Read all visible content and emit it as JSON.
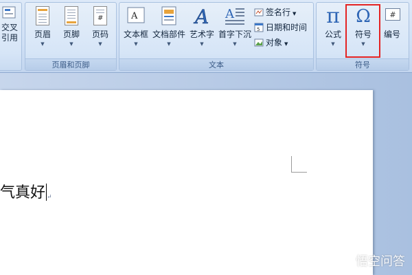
{
  "ribbon": {
    "partial_group": {
      "label_lines": [
        "交叉",
        "引用"
      ]
    },
    "header_footer_group": {
      "label": "页眉和页脚",
      "buttons": [
        {
          "label": "页眉",
          "icon": "header-page-icon"
        },
        {
          "label": "页脚",
          "icon": "footer-page-icon"
        },
        {
          "label": "页码",
          "icon": "page-number-icon"
        }
      ]
    },
    "text_group": {
      "label": "文本",
      "buttons": [
        {
          "label": "文本框",
          "icon": "text-box-icon"
        },
        {
          "label": "文档部件",
          "icon": "quick-parts-icon"
        },
        {
          "label": "艺术字",
          "icon": "wordart-icon"
        },
        {
          "label": "首字下沉",
          "icon": "drop-cap-icon"
        }
      ],
      "small_buttons": [
        {
          "label": "签名行",
          "icon": "signature-line-icon"
        },
        {
          "label": "日期和时间",
          "icon": "date-time-icon"
        },
        {
          "label": "对象",
          "icon": "object-icon"
        }
      ]
    },
    "symbols_group": {
      "label": "符号",
      "buttons": [
        {
          "label": "公式",
          "icon": "pi-icon",
          "glyph": "π"
        },
        {
          "label": "符号",
          "icon": "omega-icon",
          "glyph": "Ω"
        },
        {
          "label": "编号",
          "icon": "numbering-icon",
          "glyph": "#"
        }
      ]
    }
  },
  "document": {
    "text": "气真好",
    "paragraph_mark": "↵"
  },
  "watermark": {
    "text": "悟空问答"
  },
  "colors": {
    "highlight": "#e42222",
    "ribbon": "#d6e5f7",
    "workspace": "#b4c8e6"
  }
}
